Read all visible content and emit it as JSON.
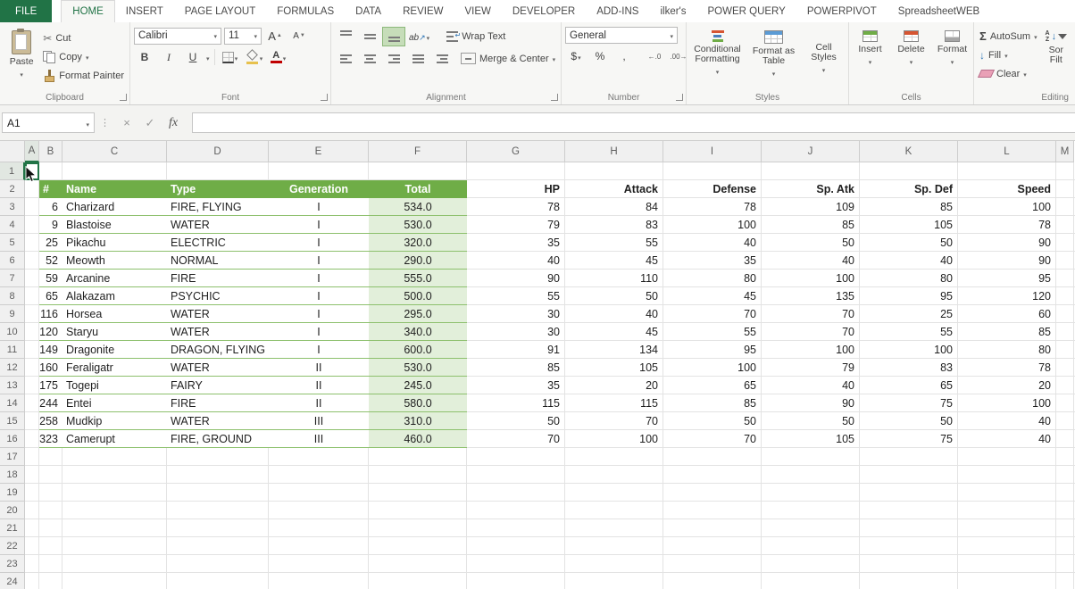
{
  "tabbar": {
    "file": "FILE",
    "tabs": [
      "HOME",
      "INSERT",
      "PAGE LAYOUT",
      "FORMULAS",
      "DATA",
      "REVIEW",
      "VIEW",
      "DEVELOPER",
      "ADD-INS",
      "ilker's",
      "POWER QUERY",
      "POWERPIVOT",
      "SpreadsheetWEB"
    ],
    "active": "HOME"
  },
  "ribbon": {
    "clipboard": {
      "label": "Clipboard",
      "paste": "Paste",
      "cut": "Cut",
      "copy": "Copy",
      "format_painter": "Format Painter"
    },
    "font": {
      "label": "Font",
      "family": "Calibri",
      "size": "11",
      "bold": "B",
      "italic": "I",
      "underline": "U"
    },
    "alignment": {
      "label": "Alignment",
      "wrap_text": "Wrap Text",
      "merge_center": "Merge & Center"
    },
    "number": {
      "label": "Number",
      "format": "General",
      "currency": "$",
      "percent": "%",
      "comma": ","
    },
    "styles": {
      "label": "Styles",
      "conditional": "Conditional Formatting",
      "format_table": "Format as Table",
      "cell_styles": "Cell Styles"
    },
    "cells": {
      "label": "Cells",
      "insert": "Insert",
      "delete": "Delete",
      "format": "Format"
    },
    "editing": {
      "label": "Editing",
      "autosum": "AutoSum",
      "fill": "Fill",
      "clear": "Clear",
      "sort_filter_line1": "Sor",
      "sort_filter_line2": "Filt"
    }
  },
  "formula_bar": {
    "name_box": "A1",
    "fx": "fx",
    "cancel": "×",
    "enter": "✓",
    "formula": ""
  },
  "sheet": {
    "columns": [
      "A",
      "B",
      "C",
      "D",
      "E",
      "F",
      "G",
      "H",
      "I",
      "J",
      "K",
      "L",
      "M"
    ],
    "rows_visible": 24,
    "selection": "A1",
    "colors": {
      "table_header": "#6FAD47",
      "total_fill": "#E2EFDA",
      "row_border": "#8DC06D",
      "excel_green": "#217346",
      "gridline": "#E3E3E3",
      "header_bg": "#F0F0F0"
    },
    "table": {
      "header_row": 2,
      "headers": [
        {
          "col": "B",
          "label": "#",
          "align": "left"
        },
        {
          "col": "C",
          "label": "Name",
          "align": "left"
        },
        {
          "col": "D",
          "label": "Type",
          "align": "left"
        },
        {
          "col": "E",
          "label": "Generation",
          "align": "center"
        },
        {
          "col": "F",
          "label": "Total",
          "align": "center"
        }
      ],
      "stat_headers": [
        {
          "col": "G",
          "label": "HP"
        },
        {
          "col": "H",
          "label": "Attack"
        },
        {
          "col": "I",
          "label": "Defense"
        },
        {
          "col": "J",
          "label": "Sp. Atk"
        },
        {
          "col": "K",
          "label": "Sp. Def"
        },
        {
          "col": "L",
          "label": "Speed"
        }
      ],
      "rows": [
        {
          "num": "6",
          "name": "Charizard",
          "type": "FIRE, FLYING",
          "generation": "I",
          "total": "534.0",
          "stats": [
            "78",
            "84",
            "78",
            "109",
            "85",
            "100"
          ]
        },
        {
          "num": "9",
          "name": "Blastoise",
          "type": "WATER",
          "generation": "I",
          "total": "530.0",
          "stats": [
            "79",
            "83",
            "100",
            "85",
            "105",
            "78"
          ]
        },
        {
          "num": "25",
          "name": "Pikachu",
          "type": "ELECTRIC",
          "generation": "I",
          "total": "320.0",
          "stats": [
            "35",
            "55",
            "40",
            "50",
            "50",
            "90"
          ]
        },
        {
          "num": "52",
          "name": "Meowth",
          "type": "NORMAL",
          "generation": "I",
          "total": "290.0",
          "stats": [
            "40",
            "45",
            "35",
            "40",
            "40",
            "90"
          ]
        },
        {
          "num": "59",
          "name": "Arcanine",
          "type": "FIRE",
          "generation": "I",
          "total": "555.0",
          "stats": [
            "90",
            "110",
            "80",
            "100",
            "80",
            "95"
          ]
        },
        {
          "num": "65",
          "name": "Alakazam",
          "type": "PSYCHIC",
          "generation": "I",
          "total": "500.0",
          "stats": [
            "55",
            "50",
            "45",
            "135",
            "95",
            "120"
          ]
        },
        {
          "num": "116",
          "name": "Horsea",
          "type": "WATER",
          "generation": "I",
          "total": "295.0",
          "stats": [
            "30",
            "40",
            "70",
            "70",
            "25",
            "60"
          ]
        },
        {
          "num": "120",
          "name": "Staryu",
          "type": "WATER",
          "generation": "I",
          "total": "340.0",
          "stats": [
            "30",
            "45",
            "55",
            "70",
            "55",
            "85"
          ]
        },
        {
          "num": "149",
          "name": "Dragonite",
          "type": "DRAGON, FLYING",
          "generation": "I",
          "total": "600.0",
          "stats": [
            "91",
            "134",
            "95",
            "100",
            "100",
            "80"
          ]
        },
        {
          "num": "160",
          "name": "Feraligatr",
          "type": "WATER",
          "generation": "II",
          "total": "530.0",
          "stats": [
            "85",
            "105",
            "100",
            "79",
            "83",
            "78"
          ]
        },
        {
          "num": "175",
          "name": "Togepi",
          "type": "FAIRY",
          "generation": "II",
          "total": "245.0",
          "stats": [
            "35",
            "20",
            "65",
            "40",
            "65",
            "20"
          ]
        },
        {
          "num": "244",
          "name": "Entei",
          "type": "FIRE",
          "generation": "II",
          "total": "580.0",
          "stats": [
            "115",
            "115",
            "85",
            "90",
            "75",
            "100"
          ]
        },
        {
          "num": "258",
          "name": "Mudkip",
          "type": "WATER",
          "generation": "III",
          "total": "310.0",
          "stats": [
            "50",
            "70",
            "50",
            "50",
            "50",
            "40"
          ]
        },
        {
          "num": "323",
          "name": "Camerupt",
          "type": "FIRE, GROUND",
          "generation": "III",
          "total": "460.0",
          "stats": [
            "70",
            "100",
            "70",
            "105",
            "75",
            "40"
          ]
        }
      ]
    }
  }
}
